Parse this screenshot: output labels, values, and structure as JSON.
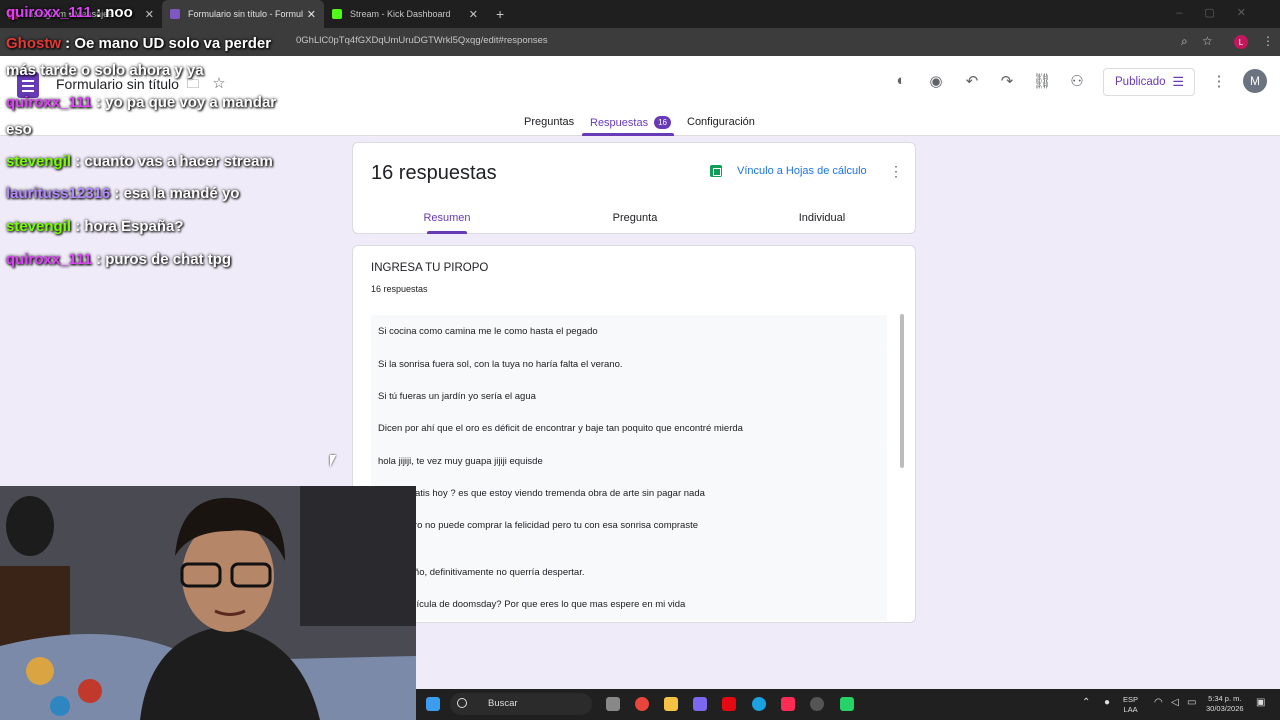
{
  "browser": {
    "tabs": [
      {
        "title": "Instagram • Mensajes"
      },
      {
        "title": "Formulario sin título - Formular"
      },
      {
        "title": "Stream - Kick Dashboard"
      }
    ],
    "url": "0GhLlC0pTq4fGXDqUmUruDGTWrkl5Qxqg/edit#responses",
    "profile_initial": "L"
  },
  "form": {
    "title": "Formulario sin título",
    "publish_label": "Publicado",
    "avatar_initial": "M",
    "nav": {
      "preguntas": "Preguntas",
      "respuestas": "Respuestas",
      "respuestas_count": "16",
      "configuracion": "Configuración"
    },
    "responses_title": "16 respuestas",
    "sheets_link": "Vínculo a Hojas de cálculo",
    "subtabs": {
      "resumen": "Resumen",
      "pregunta": "Pregunta",
      "individual": "Individual"
    },
    "question": {
      "title": "INGRESA TU PIROPO",
      "count": "16 respuestas",
      "answers": [
        "Si cocina como camina me le como hasta el pegado",
        "Si la sonrisa fuera sol, con la tuya no haría falta el verano.",
        "Si tú fueras un jardín yo sería el agua",
        "Dicen por ahí que el oro es déficit de encontrar y baje tan poquito que encontré mierda",
        "hola jijiji, te vez muy guapa jijiji equisde",
        "o esta gratis hoy ? es que estoy viendo tremenda obra de arte sin pagar nada",
        "e el dinero no puede comprar la felicidad pero tu con esa sonrisa compraste\non",
        "s un sueño, definitivamente no querría despertar.",
        "res la película de doomsday? Por que eres lo que mas espere en mi vida"
      ]
    }
  },
  "chat": [
    {
      "user": "quiroxx_111",
      "msg": ": noo",
      "color": "#e040fb"
    },
    {
      "user": "Ghostw",
      "msg": ": Oe mano UD solo va perder",
      "color": "#e53935"
    },
    {
      "user": "",
      "msg": "más tarde o solo ahora y ya",
      "color": "#ffffff"
    },
    {
      "user": "quiroxx_111",
      "msg": ": yo pa que voy a mandar",
      "color": "#e040fb"
    },
    {
      "user": "",
      "msg": "eso",
      "color": "#ffffff"
    },
    {
      "user": "stevengil",
      "msg": ": cuanto vas a hacer stream",
      "color": "#76ff03"
    },
    {
      "user": "laurituss12316",
      "msg": ": esa la mandé yo",
      "color": "#b388ff"
    },
    {
      "user": "stevengil",
      "msg": ": hora España?",
      "color": "#76ff03"
    },
    {
      "user": "quiroxx_111",
      "msg": ": puros de chat tpg",
      "color": "#e040fb"
    }
  ],
  "taskbar": {
    "search_placeholder": "Buscar",
    "lang": "ESP",
    "layout": "LAA",
    "time": "5:34 p. m.",
    "date": "30/03/2026"
  }
}
